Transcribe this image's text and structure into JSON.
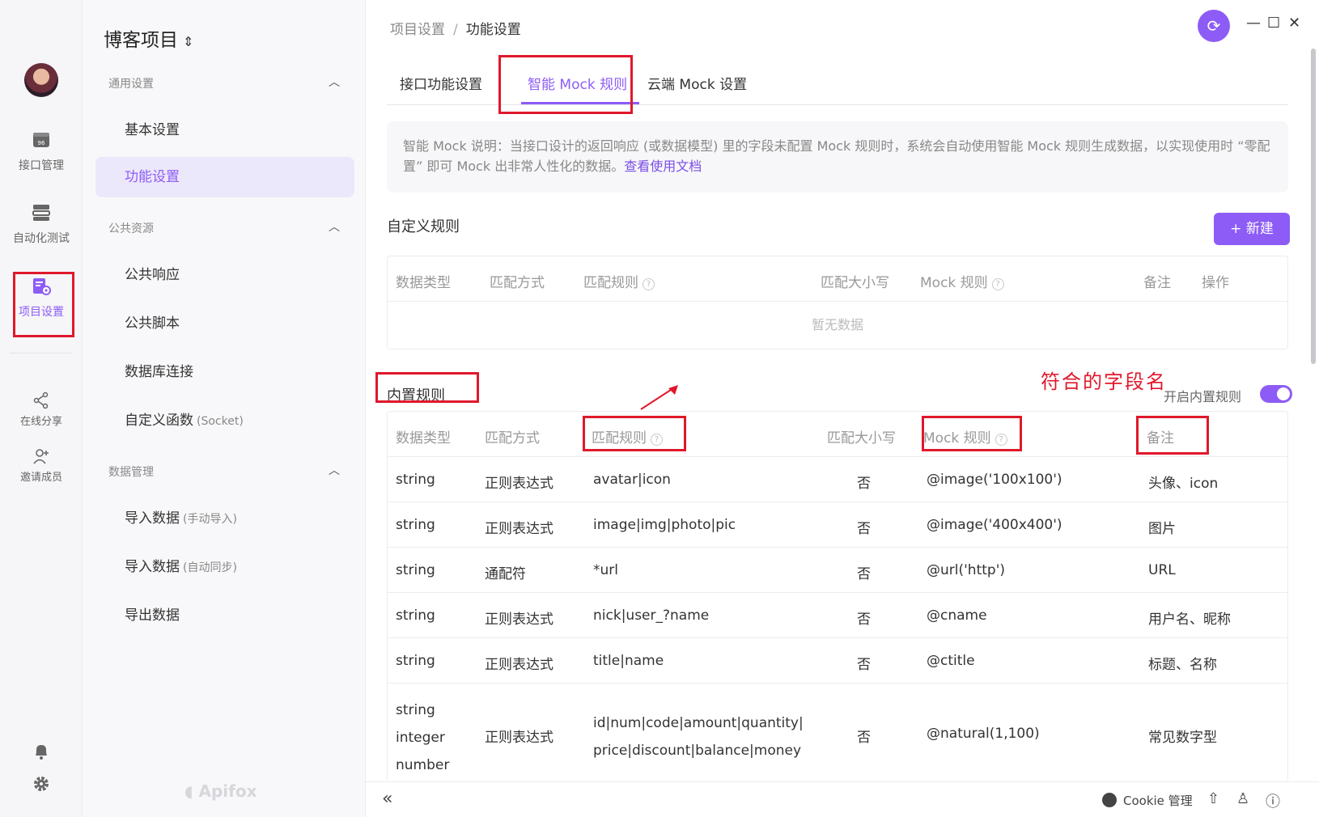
{
  "rail": {
    "items": [
      {
        "label": "接口管理"
      },
      {
        "label": "自动化测试"
      },
      {
        "label": "项目设置"
      },
      {
        "label": "在线分享"
      },
      {
        "label": "邀请成员"
      }
    ],
    "active": "项目设置"
  },
  "sidebar": {
    "project_title": "博客项目",
    "sections": [
      {
        "title": "通用设置"
      },
      {
        "title": "公共资源"
      },
      {
        "title": "数据管理"
      }
    ],
    "items": [
      {
        "label": "基本设置",
        "sub": ""
      },
      {
        "label": "功能设置",
        "sub": ""
      },
      {
        "label": "公共响应",
        "sub": ""
      },
      {
        "label": "公共脚本",
        "sub": ""
      },
      {
        "label": "数据库连接",
        "sub": ""
      },
      {
        "label": "自定义函数",
        "sub": "(Socket)"
      },
      {
        "label": "导入数据",
        "sub": "(手动导入)"
      },
      {
        "label": "导入数据",
        "sub": "(自动同步)"
      },
      {
        "label": "导出数据",
        "sub": ""
      }
    ],
    "watermark": "Apifox"
  },
  "breadcrumb": {
    "parent": "项目设置",
    "separator": "/",
    "current": "功能设置"
  },
  "tabs": [
    {
      "label": "接口功能设置"
    },
    {
      "label": "智能 Mock 规则"
    },
    {
      "label": "云端 Mock 设置"
    }
  ],
  "info": {
    "text": "智能 Mock 说明：当接口设计的返回响应 (或数据模型) 里的字段未配置 Mock 规则时，系统会自动使用智能 Mock 规则生成数据，以实现使用时 “零配置” 即可 Mock 出非常人性化的数据。",
    "link": "查看使用文档"
  },
  "custom": {
    "title": "自定义规则",
    "new_button": "+ 新建",
    "columns": [
      "数据类型",
      "匹配方式",
      "匹配规则",
      "匹配大小写",
      "Mock 规则",
      "备注",
      "操作"
    ],
    "empty": "暂无数据"
  },
  "builtin": {
    "title": "内置规则",
    "annotation": "符合的字段名",
    "toggle_label": "开启内置规则",
    "toggle_on": true,
    "columns": [
      "数据类型",
      "匹配方式",
      "匹配规则",
      "匹配大小写",
      "Mock 规则",
      "备注"
    ],
    "rows": [
      {
        "type": "string",
        "method": "正则表达式",
        "rule": "avatar|icon",
        "case": "否",
        "mock": "@image('100x100')",
        "note": "头像、icon"
      },
      {
        "type": "string",
        "method": "正则表达式",
        "rule": "image|img|photo|pic",
        "case": "否",
        "mock": "@image('400x400')",
        "note": "图片"
      },
      {
        "type": "string",
        "method": "通配符",
        "rule": "*url",
        "case": "否",
        "mock": "@url('http')",
        "note": "URL"
      },
      {
        "type": "string",
        "method": "正则表达式",
        "rule": "nick|user_?name",
        "case": "否",
        "mock": "@cname",
        "note": "用户名、昵称"
      },
      {
        "type": "string",
        "method": "正则表达式",
        "rule": "title|name",
        "case": "否",
        "mock": "@ctitle",
        "note": "标题、名称"
      },
      {
        "type_lines": [
          "string",
          "integer",
          "number"
        ],
        "method": "正则表达式",
        "rule": "id|num|code|amount|quantity|price|discount|balance|money",
        "case": "否",
        "mock": "@natural(1,100)",
        "note": "常见数字型"
      }
    ]
  },
  "footer": {
    "cookie": "Cookie 管理"
  },
  "colors": {
    "accent": "#8d5cf6",
    "annotation": "#e0182b"
  },
  "icons": [
    "api-icon",
    "automation-icon",
    "project-settings-icon",
    "share-icon",
    "invite-icon",
    "bell-icon",
    "gear-icon",
    "sync-icon",
    "collapse-icon",
    "cookie-icon",
    "upload-icon",
    "shirt-icon",
    "help-icon"
  ]
}
